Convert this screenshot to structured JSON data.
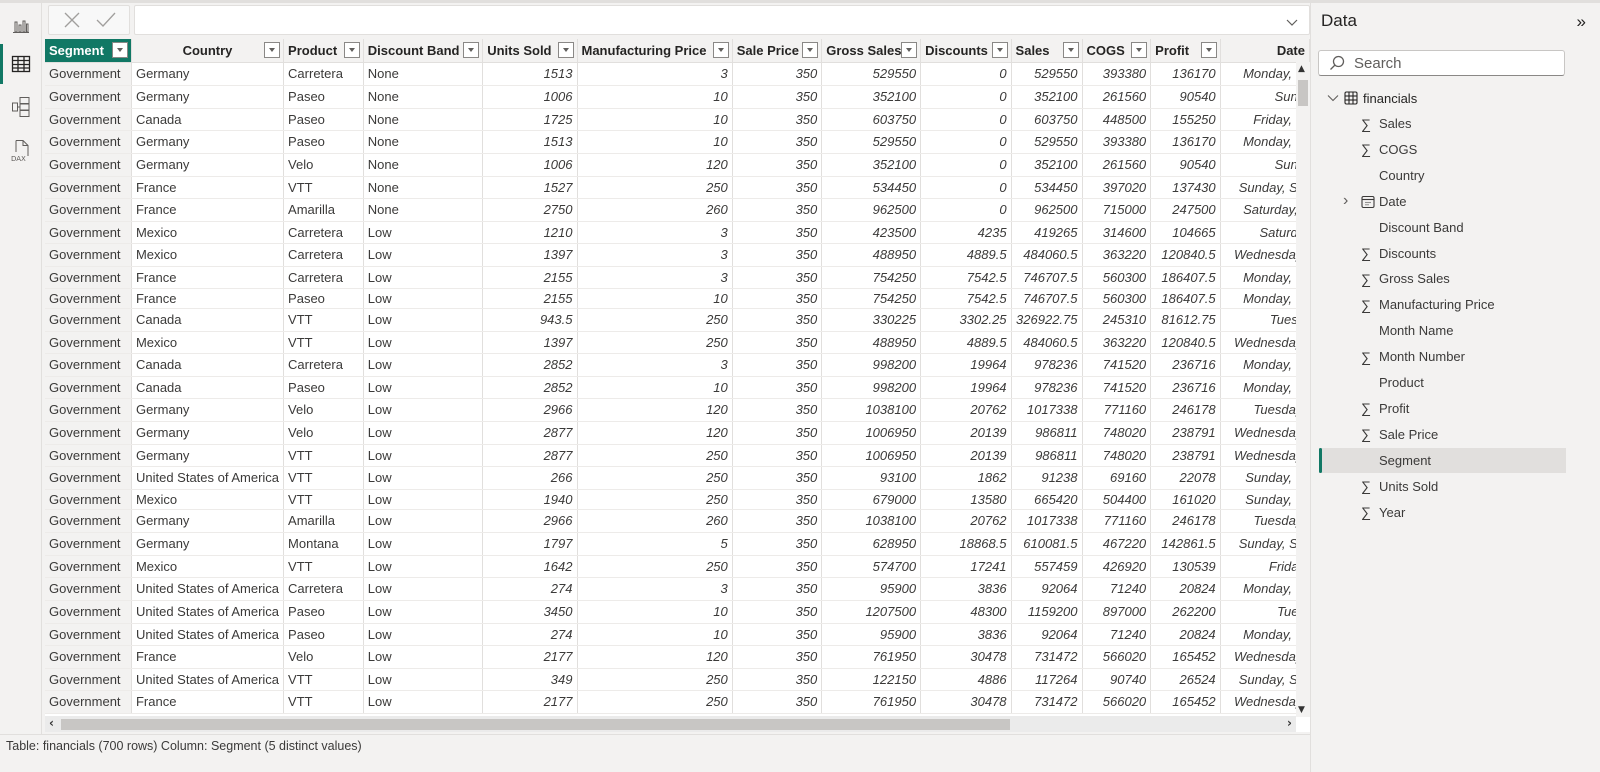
{
  "rail": {
    "items": [
      {
        "name": "report-view",
        "icon": "bar-chart-icon",
        "active": false
      },
      {
        "name": "table-view",
        "icon": "table-icon",
        "active": true
      },
      {
        "name": "model-view",
        "icon": "model-icon",
        "active": false
      },
      {
        "name": "dax-query-view",
        "icon": "dax-icon",
        "active": false
      }
    ],
    "dax_label": "DAX"
  },
  "formula_bar": {
    "value": "",
    "cancel_icon": "close-icon",
    "commit_icon": "check-icon"
  },
  "table": {
    "columns": [
      {
        "key": "segment",
        "label": "Segment"
      },
      {
        "key": "country",
        "label": "Country"
      },
      {
        "key": "product",
        "label": "Product"
      },
      {
        "key": "discount_band",
        "label": "Discount Band"
      },
      {
        "key": "units_sold",
        "label": "Units Sold"
      },
      {
        "key": "manufacturing_price",
        "label": "Manufacturing Price"
      },
      {
        "key": "sale_price",
        "label": "Sale Price"
      },
      {
        "key": "gross_sales",
        "label": "Gross Sales"
      },
      {
        "key": "discounts",
        "label": "Discounts"
      },
      {
        "key": "sales",
        "label": "Sales"
      },
      {
        "key": "cogs",
        "label": "COGS"
      },
      {
        "key": "profit",
        "label": "Profit"
      },
      {
        "key": "date",
        "label": "Date"
      }
    ],
    "rows": [
      [
        "Government",
        "Germany",
        "Carretera",
        "None",
        "1513",
        "3",
        "350",
        "529550",
        "0",
        "529550",
        "393380",
        "136170",
        "Monday, D"
      ],
      [
        "Government",
        "Germany",
        "Paseo",
        "None",
        "1006",
        "10",
        "350",
        "352100",
        "0",
        "352100",
        "261560",
        "90540",
        "Sund"
      ],
      [
        "Government",
        "Canada",
        "Paseo",
        "None",
        "1725",
        "10",
        "350",
        "603750",
        "0",
        "603750",
        "448500",
        "155250",
        "Friday, N"
      ],
      [
        "Government",
        "Germany",
        "Paseo",
        "None",
        "1513",
        "10",
        "350",
        "529550",
        "0",
        "529550",
        "393380",
        "136170",
        "Monday, D"
      ],
      [
        "Government",
        "Germany",
        "Velo",
        "None",
        "1006",
        "120",
        "350",
        "352100",
        "0",
        "352100",
        "261560",
        "90540",
        "Sund"
      ],
      [
        "Government",
        "France",
        "VTT",
        "None",
        "1527",
        "250",
        "350",
        "534450",
        "0",
        "534450",
        "397020",
        "137430",
        "Sunday, Se"
      ],
      [
        "Government",
        "France",
        "Amarilla",
        "None",
        "2750",
        "260",
        "350",
        "962500",
        "0",
        "962500",
        "715000",
        "247500",
        "Saturday, I"
      ],
      [
        "Government",
        "Mexico",
        "Carretera",
        "Low",
        "1210",
        "3",
        "350",
        "423500",
        "4235",
        "419265",
        "314600",
        "104665",
        "Saturda"
      ],
      [
        "Government",
        "Mexico",
        "Carretera",
        "Low",
        "1397",
        "3",
        "350",
        "488950",
        "4889.5",
        "484060.5",
        "363220",
        "120840.5",
        "Wednesday,"
      ],
      [
        "Government",
        "France",
        "Carretera",
        "Low",
        "2155",
        "3",
        "350",
        "754250",
        "7542.5",
        "746707.5",
        "560300",
        "186407.5",
        "Monday, D"
      ],
      [
        "Government",
        "France",
        "Paseo",
        "Low",
        "2155",
        "10",
        "350",
        "754250",
        "7542.5",
        "746707.5",
        "560300",
        "186407.5",
        "Monday, D"
      ],
      [
        "Government",
        "Canada",
        "VTT",
        "Low",
        "943.5",
        "250",
        "350",
        "330225",
        "3302.25",
        "326922.75",
        "245310",
        "81612.75",
        "Tuesa"
      ],
      [
        "Government",
        "Mexico",
        "VTT",
        "Low",
        "1397",
        "250",
        "350",
        "488950",
        "4889.5",
        "484060.5",
        "363220",
        "120840.5",
        "Wednesday,"
      ],
      [
        "Government",
        "Canada",
        "Carretera",
        "Low",
        "2852",
        "3",
        "350",
        "998200",
        "19964",
        "978236",
        "741520",
        "236716",
        "Monday, D"
      ],
      [
        "Government",
        "Canada",
        "Paseo",
        "Low",
        "2852",
        "10",
        "350",
        "998200",
        "19964",
        "978236",
        "741520",
        "236716",
        "Monday, D"
      ],
      [
        "Government",
        "Germany",
        "Velo",
        "Low",
        "2966",
        "120",
        "350",
        "1038100",
        "20762",
        "1017338",
        "771160",
        "246178",
        "Tuesday,"
      ],
      [
        "Government",
        "Germany",
        "Velo",
        "Low",
        "2877",
        "120",
        "350",
        "1006950",
        "20139",
        "986811",
        "748020",
        "238791",
        "Wednesday,"
      ],
      [
        "Government",
        "Germany",
        "VTT",
        "Low",
        "2877",
        "250",
        "350",
        "1006950",
        "20139",
        "986811",
        "748020",
        "238791",
        "Wednesday,"
      ],
      [
        "Government",
        "United States of America",
        "VTT",
        "Low",
        "266",
        "250",
        "350",
        "93100",
        "1862",
        "91238",
        "69160",
        "22078",
        "Sunday, D"
      ],
      [
        "Government",
        "Mexico",
        "VTT",
        "Low",
        "1940",
        "250",
        "350",
        "679000",
        "13580",
        "665420",
        "504400",
        "161020",
        "Sunday, D"
      ],
      [
        "Government",
        "Germany",
        "Amarilla",
        "Low",
        "2966",
        "260",
        "350",
        "1038100",
        "20762",
        "1017338",
        "771160",
        "246178",
        "Tuesday,"
      ],
      [
        "Government",
        "Germany",
        "Montana",
        "Low",
        "1797",
        "5",
        "350",
        "628950",
        "18868.5",
        "610081.5",
        "467220",
        "142861.5",
        "Sunday, Se"
      ],
      [
        "Government",
        "Mexico",
        "VTT",
        "Low",
        "1642",
        "250",
        "350",
        "574700",
        "17241",
        "557459",
        "426920",
        "130539",
        "Friday"
      ],
      [
        "Government",
        "United States of America",
        "Carretera",
        "Low",
        "274",
        "3",
        "350",
        "95900",
        "3836",
        "92064",
        "71240",
        "20824",
        "Monday, D"
      ],
      [
        "Government",
        "United States of America",
        "Paseo",
        "Low",
        "3450",
        "10",
        "350",
        "1207500",
        "48300",
        "1159200",
        "897000",
        "262200",
        "Tues"
      ],
      [
        "Government",
        "United States of America",
        "Paseo",
        "Low",
        "274",
        "10",
        "350",
        "95900",
        "3836",
        "92064",
        "71240",
        "20824",
        "Monday, D"
      ],
      [
        "Government",
        "France",
        "Velo",
        "Low",
        "2177",
        "120",
        "350",
        "761950",
        "30478",
        "731472",
        "566020",
        "165452",
        "Wednesday,"
      ],
      [
        "Government",
        "United States of America",
        "VTT",
        "Low",
        "349",
        "250",
        "350",
        "122150",
        "4886",
        "117264",
        "90740",
        "26524",
        "Sunday, Se"
      ],
      [
        "Government",
        "France",
        "VTT",
        "Low",
        "2177",
        "250",
        "350",
        "761950",
        "30478",
        "731472",
        "566020",
        "165452",
        "Wednesday,"
      ]
    ]
  },
  "status_bar": {
    "text": "Table: financials (700 rows) Column: Segment (5 distinct values)"
  },
  "data_pane": {
    "title": "Data",
    "collapse_icon": "double-chevron-right-icon",
    "search_placeholder": "Search",
    "table_name": "financials",
    "fields": [
      {
        "label": "Sales",
        "type": "sum"
      },
      {
        "label": "COGS",
        "type": "sum"
      },
      {
        "label": "Country",
        "type": "text"
      },
      {
        "label": "Date",
        "type": "date"
      },
      {
        "label": "Discount Band",
        "type": "text"
      },
      {
        "label": "Discounts",
        "type": "sum"
      },
      {
        "label": "Gross Sales",
        "type": "sum"
      },
      {
        "label": "Manufacturing Price",
        "type": "sum"
      },
      {
        "label": "Month Name",
        "type": "text"
      },
      {
        "label": "Month Number",
        "type": "sum"
      },
      {
        "label": "Product",
        "type": "text"
      },
      {
        "label": "Profit",
        "type": "sum"
      },
      {
        "label": "Sale Price",
        "type": "sum"
      },
      {
        "label": "Segment",
        "type": "text",
        "selected": true
      },
      {
        "label": "Units Sold",
        "type": "sum"
      },
      {
        "label": "Year",
        "type": "sum"
      }
    ]
  },
  "colors": {
    "accent": "#117865",
    "background": "#f3f2f1",
    "grid_border": "#e1dfdd"
  }
}
